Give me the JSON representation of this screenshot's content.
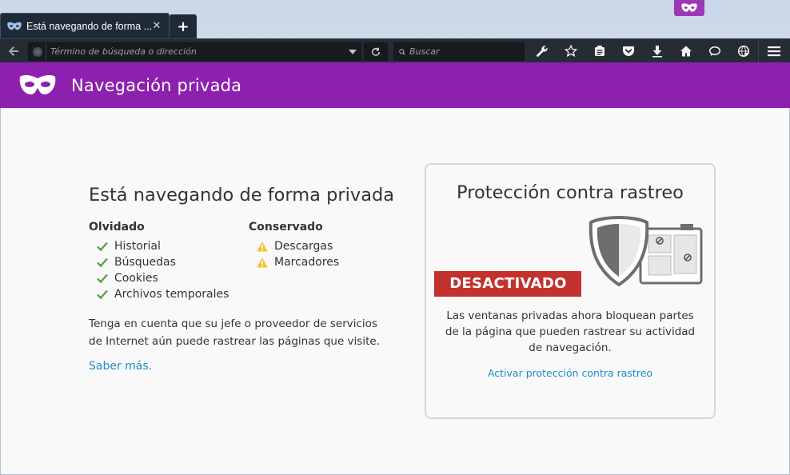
{
  "window": {
    "tab_title": "Está navegando de forma ...",
    "tab_close": "✕",
    "new_tab": "+"
  },
  "navbar": {
    "url_placeholder": "Término de búsqueda o dirección",
    "search_placeholder": "Buscar"
  },
  "header": {
    "title": "Navegación privada"
  },
  "main": {
    "heading": "Está navegando de forma privada",
    "forgotten": {
      "title": "Olvidado",
      "items": [
        "Historial",
        "Búsquedas",
        "Cookies",
        "Archivos temporales"
      ]
    },
    "kept": {
      "title": "Conservado",
      "items": [
        "Descargas",
        "Marcadores"
      ]
    },
    "note": "Tenga en cuenta que su jefe o proveedor de servicios de Internet aún puede rastrear las páginas que visite.",
    "learn_more": "Saber más."
  },
  "tracking": {
    "title": "Protección contra rastreo",
    "status": "DESACTIVADO",
    "description": "Las ventanas privadas ahora bloquean partes de la página que pueden rastrear su actividad de navegación.",
    "enable_link": "Activar protección contra rastreo"
  },
  "colors": {
    "private_purple": "#8d20ae",
    "status_red": "#c4322f",
    "check_green": "#56a044",
    "warning_yellow": "#f0c02a",
    "link_blue": "#1a8ec8"
  }
}
